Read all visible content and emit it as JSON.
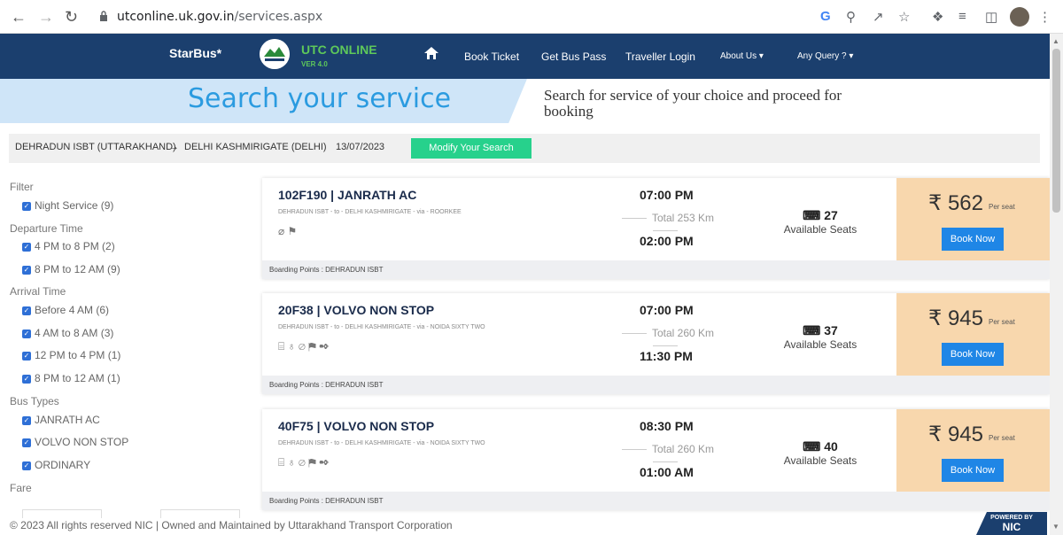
{
  "browser": {
    "url_host": "utconline.uk.gov.in",
    "url_path": "/services.aspx"
  },
  "nav": {
    "brand": "StarBus*",
    "utc_title": "UTC ONLINE",
    "version": "VER 4.0",
    "items": [
      "Book Ticket",
      "Get Bus Pass",
      "Traveller Login",
      "About Us ▾",
      "Any Query ? ▾"
    ]
  },
  "hero": {
    "title": "Search your service",
    "subtitle": "Search for service of your choice and proceed for booking"
  },
  "search": {
    "from": "DEHRADUN ISBT (UTTARAKHAND)",
    "arrow": "→",
    "to": "DELHI KASHMIRIGATE (DELHI)",
    "date": "13/07/2023",
    "modify_label": "Modify Your Search"
  },
  "filters": {
    "title": "Filter",
    "night": "Night Service (9)",
    "departure_title": "Departure Time",
    "departure": [
      "4 PM to 8 PM (2)",
      "8 PM to 12 AM (9)"
    ],
    "arrival_title": "Arrival Time",
    "arrival": [
      "Before 4 AM (6)",
      "4 AM to 8 AM (3)",
      "12 PM to 4 PM (1)",
      "8 PM to 12 AM (1)"
    ],
    "bus_title": "Bus Types",
    "bus": [
      "JANRATH AC",
      "VOLVO NON STOP",
      "ORDINARY"
    ],
    "fare_title": "Fare"
  },
  "services": [
    {
      "name": "102F190 | JANRATH AC",
      "route": "DEHRADUN ISBT - to - DELHI KASHMIRIGATE - via - ROORKEE",
      "amenities": "⌀ ⚑",
      "departure": "07:00 PM",
      "distance": "Total 253 Km",
      "arrival": "02:00 PM",
      "seats": "27",
      "seats_label": "Available Seats",
      "price": "₹ 562",
      "per_seat": "Per seat",
      "book_label": "Book Now",
      "boarding": "Boarding Points : DEHRADUN ISBT"
    },
    {
      "name": "20F38 | VOLVO NON STOP",
      "route": "DEHRADUN ISBT - to - DELHI KASHMIRIGATE - via - NOIDA SIXTY TWO",
      "amenities": "⌸ ♁ ⌀ ⚑ ✒",
      "departure": "07:00 PM",
      "distance": "Total 260 Km",
      "arrival": "11:30 PM",
      "seats": "37",
      "seats_label": "Available Seats",
      "price": "₹ 945",
      "per_seat": "Per seat",
      "book_label": "Book Now",
      "boarding": "Boarding Points : DEHRADUN ISBT"
    },
    {
      "name": "40F75 | VOLVO NON STOP",
      "route": "DEHRADUN ISBT - to - DELHI KASHMIRIGATE - via - NOIDA SIXTY TWO",
      "amenities": "⌸ ♁ ⌀ ⚑ ✒",
      "departure": "08:30 PM",
      "distance": "Total 260 Km",
      "arrival": "01:00 AM",
      "seats": "40",
      "seats_label": "Available Seats",
      "price": "₹ 945",
      "per_seat": "Per seat",
      "book_label": "Book Now",
      "boarding": "Boarding Points : DEHRADUN ISBT"
    }
  ],
  "footer": {
    "text": "© 2023 All rights reserved NIC | Owned and Maintained by Uttarakhand Transport Corporation",
    "nic_small": "POWERED BY",
    "nic_big": "NIC"
  }
}
